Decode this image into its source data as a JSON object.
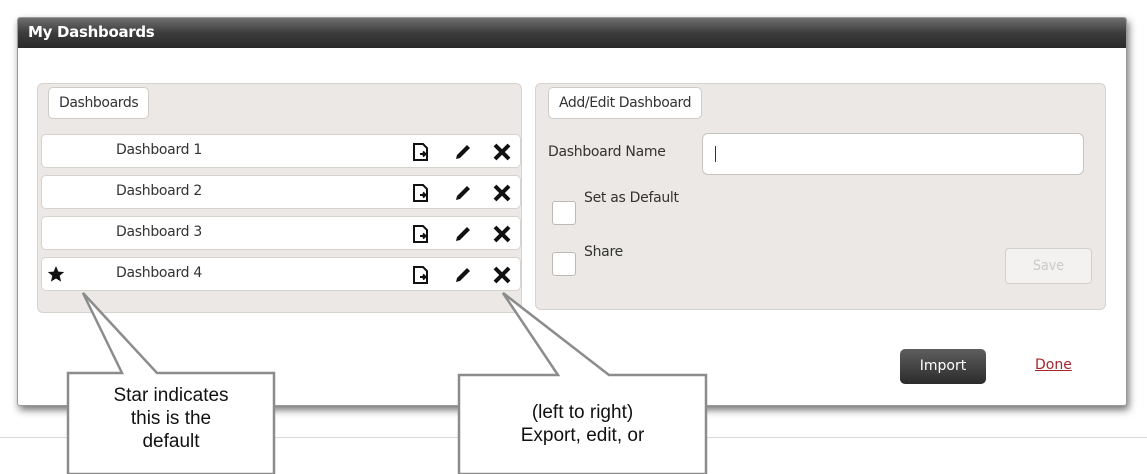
{
  "dialog": {
    "title": "My Dashboards"
  },
  "dashboards_panel": {
    "tab_label": "Dashboards",
    "rows": [
      {
        "name": "Dashboard 1",
        "is_default": false
      },
      {
        "name": "Dashboard 2",
        "is_default": false
      },
      {
        "name": "Dashboard 3",
        "is_default": false
      },
      {
        "name": "Dashboard 4",
        "is_default": true
      }
    ],
    "row_actions": [
      "export-icon",
      "edit-icon",
      "delete-icon"
    ]
  },
  "edit_panel": {
    "tab_label": "Add/Edit Dashboard",
    "name_label": "Dashboard Name",
    "name_value": "",
    "default_label": "Set as Default",
    "default_checked": false,
    "share_label": "Share",
    "share_checked": false,
    "save_label": "Save"
  },
  "footer": {
    "import_label": "Import",
    "done_label": "Done"
  },
  "callouts": {
    "star_lines": [
      "Star indicates",
      "this is the",
      "default"
    ],
    "actions_lines": [
      "(left to right)",
      "Export, edit, or"
    ]
  },
  "colors": {
    "header_dark": "#2a2a2a",
    "panel_bg": "#ebe8e5",
    "done_link": "#a0282d",
    "import_btn": "#3a3a3a"
  }
}
